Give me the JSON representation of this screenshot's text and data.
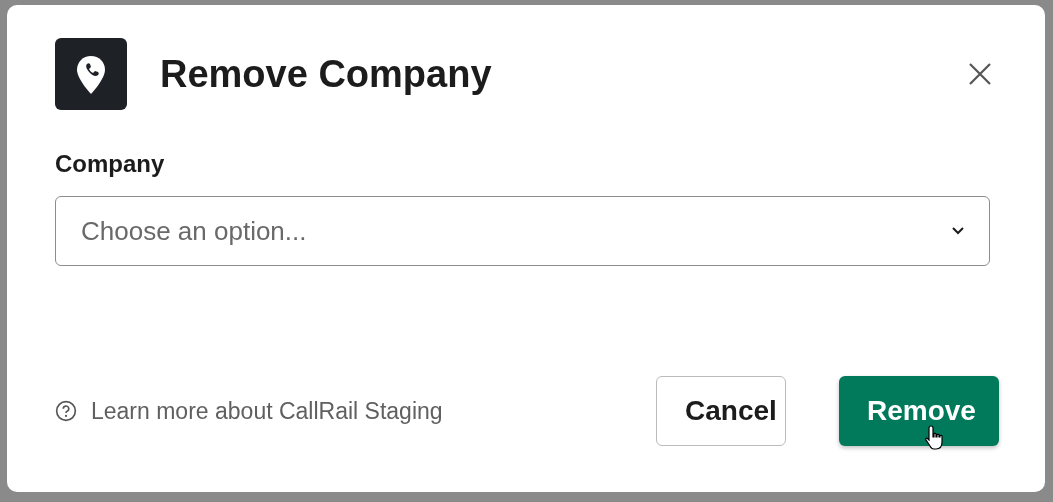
{
  "dialog": {
    "title": "Remove Company",
    "field": {
      "label": "Company",
      "placeholder": "Choose an option..."
    },
    "help_link": "Learn more about CallRail Staging",
    "buttons": [
      {
        "label": "Cancel",
        "kind": "secondary"
      },
      {
        "label": "Remove",
        "kind": "primary"
      }
    ]
  }
}
